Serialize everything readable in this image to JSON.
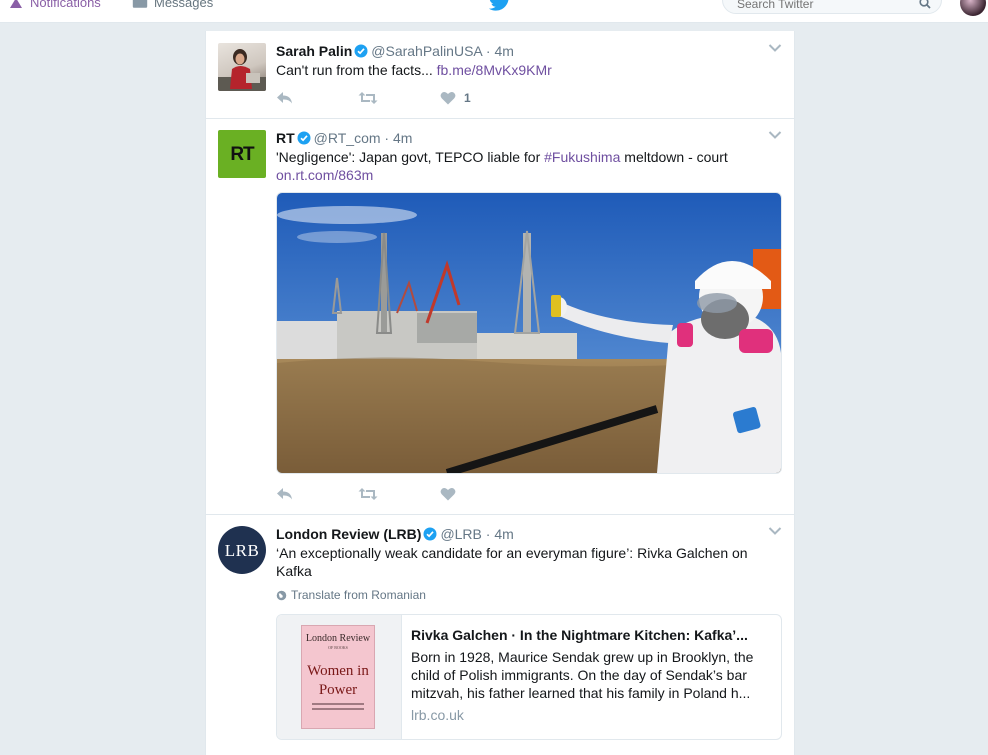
{
  "nav": {
    "notifications_label": "Notifications",
    "messages_label": "Messages",
    "search_placeholder": "Search Twitter"
  },
  "colors": {
    "link": "#6f4fa0",
    "verified": "#1da1f2",
    "twitter_blue": "#1da1f2",
    "rt_green": "#6ab023",
    "lrb_navy": "#1f3150"
  },
  "tweets": [
    {
      "fullname": "Sarah Palin",
      "username": "@SarahPalinUSA",
      "separator": "·",
      "time": "4m",
      "text": "Can't run from the facts...",
      "link": "fb.me/8MvKx9KMr",
      "like_count": "1"
    },
    {
      "fullname": "RT",
      "avatar_text": "RT",
      "username": "@RT_com",
      "separator": "·",
      "time": "4m",
      "text_before": "'Negligence': Japan govt, TEPCO liable for",
      "hashtag": "#Fukushima",
      "text_after": "meltdown - court",
      "link": "on.rt.com/863m"
    },
    {
      "fullname": "London Review (LRB)",
      "avatar_text": "LRB",
      "username": "@LRB",
      "separator": "·",
      "time": "4m",
      "text": "‘An exceptionally weak candidate for an everyman figure’: Rivka Galchen on Kafka",
      "translate_label": "Translate from Romanian",
      "card": {
        "title": "Rivka Galchen · In the Nightmare Kitchen: Kafka’...",
        "description": "Born in 1928, Maurice Sendak grew up in Brooklyn, the child of Polish immigrants. On the day of Sendak’s bar mitzvah, his father learned that his family in Poland h...",
        "domain": "lrb.co.uk",
        "cover_masthead": "London Review",
        "cover_sub": "OF BOOKS",
        "cover_title": "Women in Power"
      }
    }
  ]
}
